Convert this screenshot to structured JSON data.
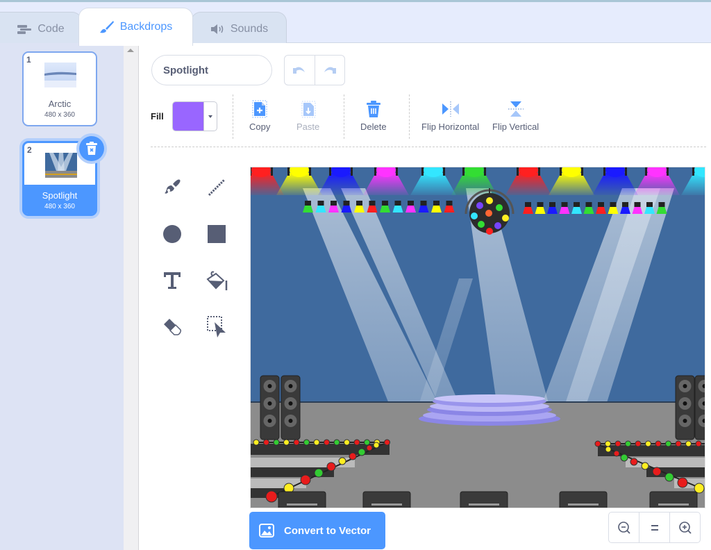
{
  "tabs": [
    {
      "label": "Code",
      "icon": "code-blocks-icon",
      "active": false
    },
    {
      "label": "Backdrops",
      "icon": "paintbrush-icon",
      "active": true
    },
    {
      "label": "Sounds",
      "icon": "speaker-icon",
      "active": false
    }
  ],
  "backdrops": [
    {
      "number": "1",
      "name": "Arctic",
      "size": "480 x 360",
      "selected": false
    },
    {
      "number": "2",
      "name": "Spotlight",
      "size": "480 x 360",
      "selected": true
    }
  ],
  "editor": {
    "costume_name": "Spotlight",
    "fill_label": "Fill",
    "fill_color": "#9966ff",
    "actions": {
      "copy": "Copy",
      "paste": "Paste",
      "delete": "Delete",
      "flip_horizontal": "Flip Horizontal",
      "flip_vertical": "Flip Vertical"
    },
    "tools": [
      "brush",
      "line",
      "circle",
      "rectangle",
      "text",
      "fill",
      "eraser",
      "select"
    ],
    "convert_label": "Convert to Vector"
  },
  "colors": {
    "accent": "#4c97ff",
    "text": "#575e75",
    "sidebar_bg": "#dde3f4"
  }
}
